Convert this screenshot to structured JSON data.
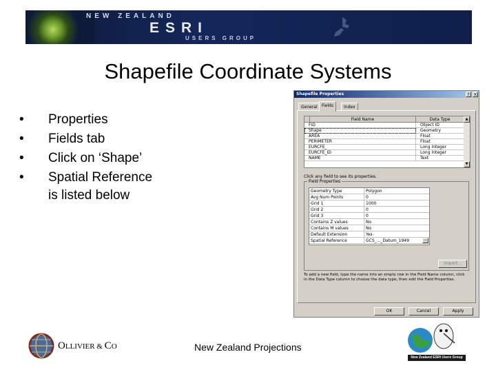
{
  "banner": {
    "line1": "NEW ZEALAND",
    "line2": "ESRI",
    "line3": "USERS GROUP"
  },
  "title": "Shapefile Coordinate Systems",
  "bullets": [
    {
      "text": "Properties"
    },
    {
      "text": "Fields tab"
    },
    {
      "text": "Click on ‘Shape’"
    },
    {
      "text": "Spatial Reference",
      "cont": "is listed below"
    }
  ],
  "dialog": {
    "title": "Shapefile Properties",
    "help": "?",
    "close": "×",
    "tabs": [
      "General",
      "Fields",
      "Index"
    ],
    "active_tab": "Fields",
    "grid_headers": [
      "Field Name",
      "Data Type"
    ],
    "rows": [
      {
        "name": "FID",
        "type": "Object ID"
      },
      {
        "name": "Shape",
        "type": "Geometry"
      },
      {
        "name": "AREA",
        "type": "Float"
      },
      {
        "name": "PERIMETER",
        "type": "Float"
      },
      {
        "name": "EURCFE_",
        "type": "Long Integer"
      },
      {
        "name": "EURCFE_ID",
        "type": "Long Integer"
      },
      {
        "name": "NAME",
        "type": "Text"
      }
    ],
    "hint": "Click any field to see its properties.",
    "field_properties_label": "Field Properties",
    "field_properties": [
      {
        "k": "Geometry Type",
        "v": "Polygon"
      },
      {
        "k": "Avg Num Points",
        "v": "0"
      },
      {
        "k": "Grid 1",
        "v": "1000"
      },
      {
        "k": "Grid 2",
        "v": "0"
      },
      {
        "k": "Grid 3",
        "v": "0"
      },
      {
        "k": "Contains Z values",
        "v": "No"
      },
      {
        "k": "Contains M values",
        "v": "No"
      },
      {
        "k": "Default Extension",
        "v": "Yes"
      },
      {
        "k": "Spatial Reference",
        "v": "GCS_..._Datum_1949"
      }
    ],
    "ellipsis": "...",
    "import_label": "Import...",
    "instructions": "To add a new field, type the name into an empty row in the Field Name column, click in the Data Type column to choose the data type, then edit the Field Properties.",
    "buttons": [
      "OK",
      "Cancel",
      "Apply"
    ]
  },
  "footer": {
    "company_o": "O",
    "company_rest": "LLIVIER",
    "company_amp": " & ",
    "company_c": "C",
    "company_o2": "O",
    "center": "New Zealand Projections",
    "esri_badge": "New Zealand ESRI Users Group"
  }
}
